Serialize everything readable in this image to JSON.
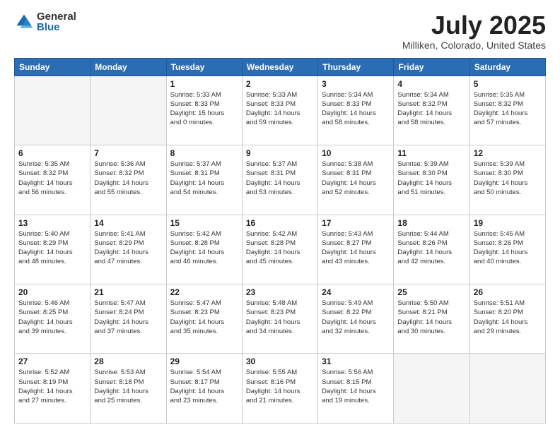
{
  "logo": {
    "general": "General",
    "blue": "Blue"
  },
  "title": "July 2025",
  "subtitle": "Milliken, Colorado, United States",
  "weekdays": [
    "Sunday",
    "Monday",
    "Tuesday",
    "Wednesday",
    "Thursday",
    "Friday",
    "Saturday"
  ],
  "weeks": [
    [
      {
        "day": "",
        "info": ""
      },
      {
        "day": "",
        "info": ""
      },
      {
        "day": "1",
        "info": "Sunrise: 5:33 AM\nSunset: 8:33 PM\nDaylight: 15 hours\nand 0 minutes."
      },
      {
        "day": "2",
        "info": "Sunrise: 5:33 AM\nSunset: 8:33 PM\nDaylight: 14 hours\nand 59 minutes."
      },
      {
        "day": "3",
        "info": "Sunrise: 5:34 AM\nSunset: 8:33 PM\nDaylight: 14 hours\nand 58 minutes."
      },
      {
        "day": "4",
        "info": "Sunrise: 5:34 AM\nSunset: 8:32 PM\nDaylight: 14 hours\nand 58 minutes."
      },
      {
        "day": "5",
        "info": "Sunrise: 5:35 AM\nSunset: 8:32 PM\nDaylight: 14 hours\nand 57 minutes."
      }
    ],
    [
      {
        "day": "6",
        "info": "Sunrise: 5:35 AM\nSunset: 8:32 PM\nDaylight: 14 hours\nand 56 minutes."
      },
      {
        "day": "7",
        "info": "Sunrise: 5:36 AM\nSunset: 8:32 PM\nDaylight: 14 hours\nand 55 minutes."
      },
      {
        "day": "8",
        "info": "Sunrise: 5:37 AM\nSunset: 8:31 PM\nDaylight: 14 hours\nand 54 minutes."
      },
      {
        "day": "9",
        "info": "Sunrise: 5:37 AM\nSunset: 8:31 PM\nDaylight: 14 hours\nand 53 minutes."
      },
      {
        "day": "10",
        "info": "Sunrise: 5:38 AM\nSunset: 8:31 PM\nDaylight: 14 hours\nand 52 minutes."
      },
      {
        "day": "11",
        "info": "Sunrise: 5:39 AM\nSunset: 8:30 PM\nDaylight: 14 hours\nand 51 minutes."
      },
      {
        "day": "12",
        "info": "Sunrise: 5:39 AM\nSunset: 8:30 PM\nDaylight: 14 hours\nand 50 minutes."
      }
    ],
    [
      {
        "day": "13",
        "info": "Sunrise: 5:40 AM\nSunset: 8:29 PM\nDaylight: 14 hours\nand 48 minutes."
      },
      {
        "day": "14",
        "info": "Sunrise: 5:41 AM\nSunset: 8:29 PM\nDaylight: 14 hours\nand 47 minutes."
      },
      {
        "day": "15",
        "info": "Sunrise: 5:42 AM\nSunset: 8:28 PM\nDaylight: 14 hours\nand 46 minutes."
      },
      {
        "day": "16",
        "info": "Sunrise: 5:42 AM\nSunset: 8:28 PM\nDaylight: 14 hours\nand 45 minutes."
      },
      {
        "day": "17",
        "info": "Sunrise: 5:43 AM\nSunset: 8:27 PM\nDaylight: 14 hours\nand 43 minutes."
      },
      {
        "day": "18",
        "info": "Sunrise: 5:44 AM\nSunset: 8:26 PM\nDaylight: 14 hours\nand 42 minutes."
      },
      {
        "day": "19",
        "info": "Sunrise: 5:45 AM\nSunset: 8:26 PM\nDaylight: 14 hours\nand 40 minutes."
      }
    ],
    [
      {
        "day": "20",
        "info": "Sunrise: 5:46 AM\nSunset: 8:25 PM\nDaylight: 14 hours\nand 39 minutes."
      },
      {
        "day": "21",
        "info": "Sunrise: 5:47 AM\nSunset: 8:24 PM\nDaylight: 14 hours\nand 37 minutes."
      },
      {
        "day": "22",
        "info": "Sunrise: 5:47 AM\nSunset: 8:23 PM\nDaylight: 14 hours\nand 35 minutes."
      },
      {
        "day": "23",
        "info": "Sunrise: 5:48 AM\nSunset: 8:23 PM\nDaylight: 14 hours\nand 34 minutes."
      },
      {
        "day": "24",
        "info": "Sunrise: 5:49 AM\nSunset: 8:22 PM\nDaylight: 14 hours\nand 32 minutes."
      },
      {
        "day": "25",
        "info": "Sunrise: 5:50 AM\nSunset: 8:21 PM\nDaylight: 14 hours\nand 30 minutes."
      },
      {
        "day": "26",
        "info": "Sunrise: 5:51 AM\nSunset: 8:20 PM\nDaylight: 14 hours\nand 29 minutes."
      }
    ],
    [
      {
        "day": "27",
        "info": "Sunrise: 5:52 AM\nSunset: 8:19 PM\nDaylight: 14 hours\nand 27 minutes."
      },
      {
        "day": "28",
        "info": "Sunrise: 5:53 AM\nSunset: 8:18 PM\nDaylight: 14 hours\nand 25 minutes."
      },
      {
        "day": "29",
        "info": "Sunrise: 5:54 AM\nSunset: 8:17 PM\nDaylight: 14 hours\nand 23 minutes."
      },
      {
        "day": "30",
        "info": "Sunrise: 5:55 AM\nSunset: 8:16 PM\nDaylight: 14 hours\nand 21 minutes."
      },
      {
        "day": "31",
        "info": "Sunrise: 5:56 AM\nSunset: 8:15 PM\nDaylight: 14 hours\nand 19 minutes."
      },
      {
        "day": "",
        "info": ""
      },
      {
        "day": "",
        "info": ""
      }
    ]
  ]
}
